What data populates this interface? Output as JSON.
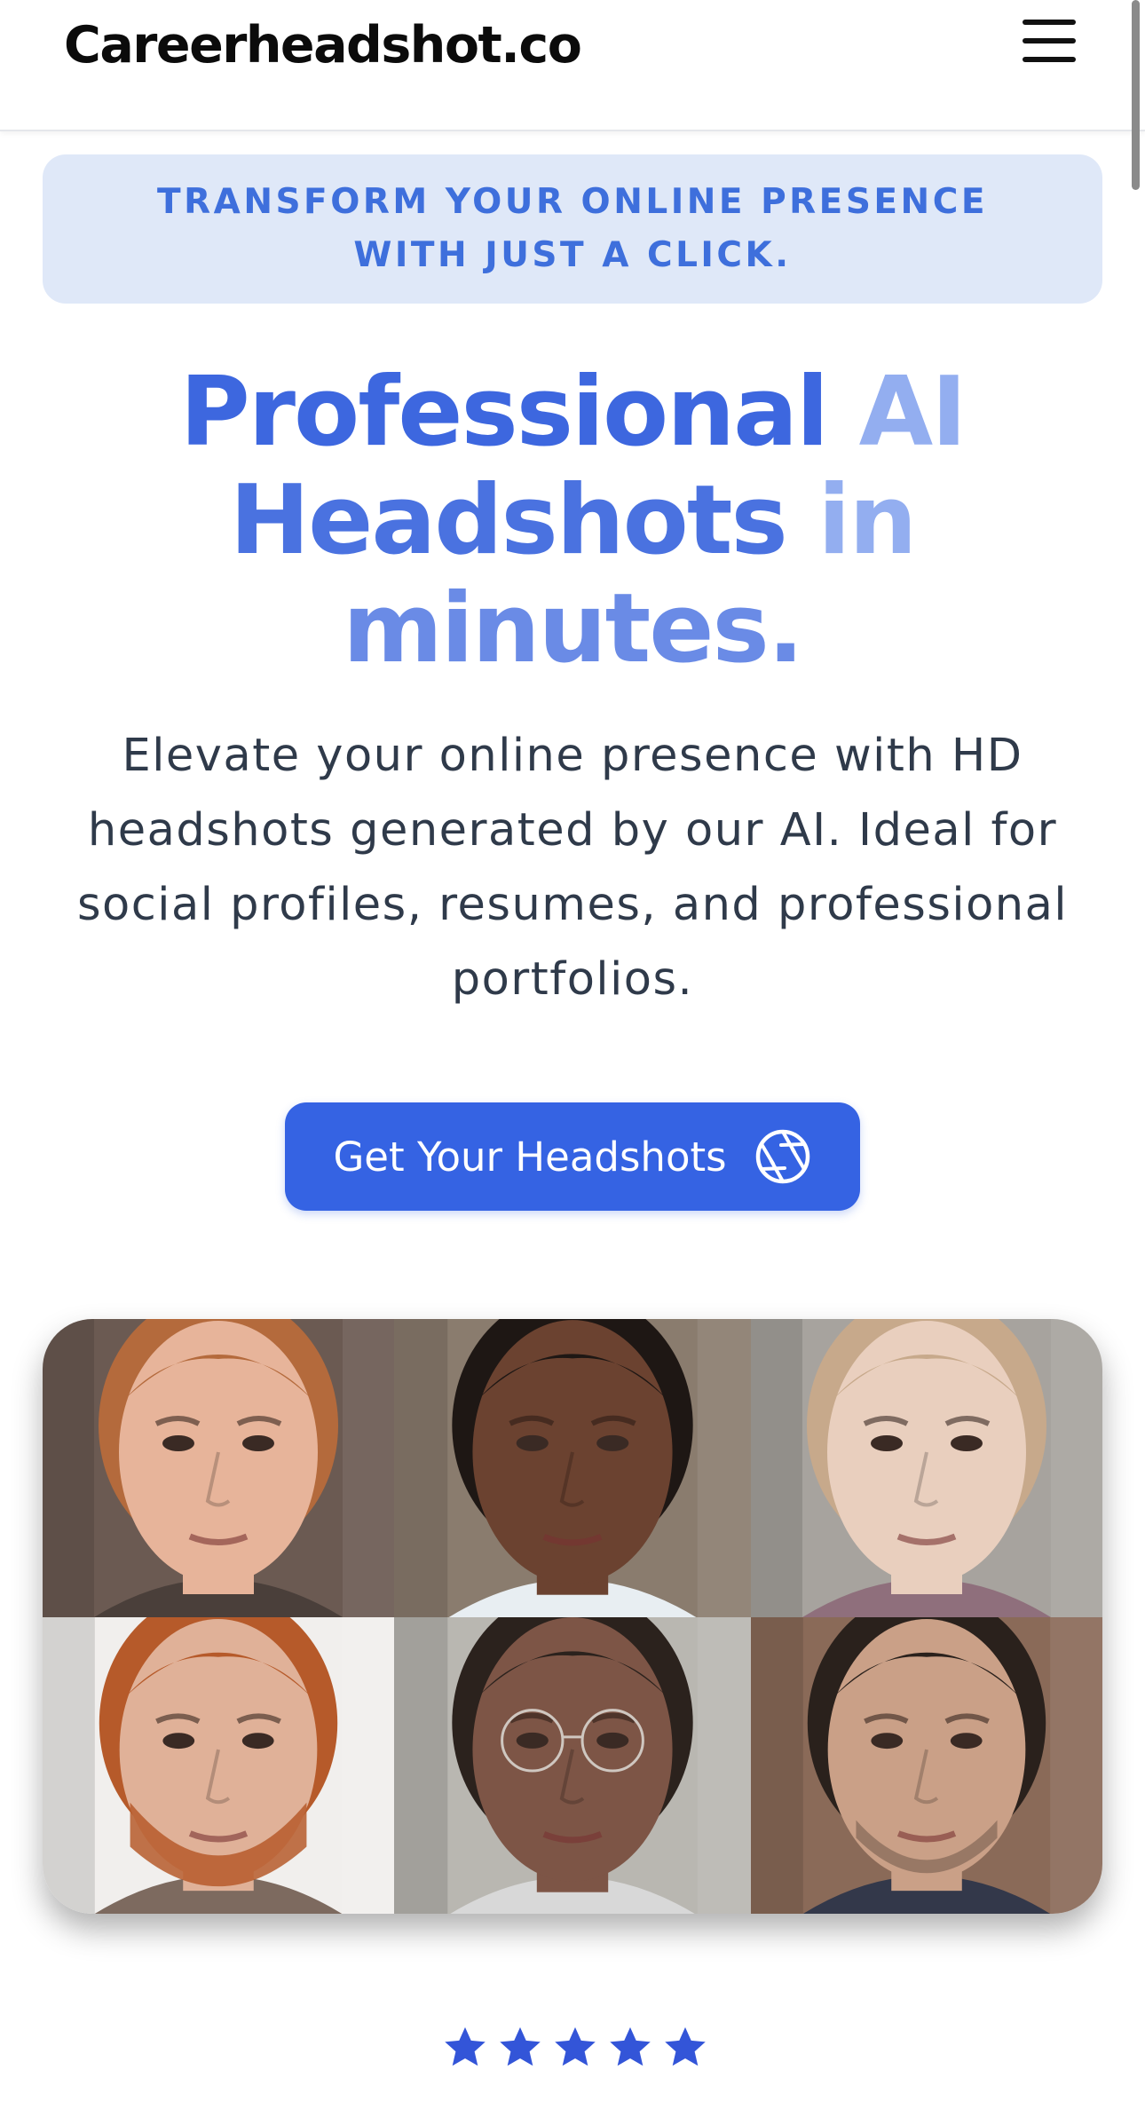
{
  "header": {
    "logo": "Careerheadshot.co",
    "menu_icon": "hamburger-menu-icon"
  },
  "banner": {
    "text": "TRANSFORM YOUR ONLINE PRESENCE WITH JUST A CLICK."
  },
  "hero": {
    "headline_words": [
      "Professional",
      "AI",
      "Headshots",
      "in",
      "minutes."
    ],
    "subtext": "Elevate your online presence with HD headshots generated by our AI. Ideal for social profiles, resumes, and professional portfolios.",
    "cta_label": "Get Your Headshots",
    "cta_icon": "camera-aperture-icon"
  },
  "gallery": {
    "faces": [
      {
        "hair": "#b46a3c",
        "skin": "#e7b49a",
        "bg": "#6b5a52",
        "shirt": "#4a3f3a"
      },
      {
        "hair": "#1e1714",
        "skin": "#6b4230",
        "bg": "#8a7c6e",
        "shirt": "#e8eef2"
      },
      {
        "hair": "#c7a98b",
        "skin": "#e9cfbe",
        "bg": "#a7a39e",
        "shirt": "#8f6f7c"
      },
      {
        "hair": "#b65a2a",
        "skin": "#e0b198",
        "bg": "#f1efed",
        "shirt": "#7d6a5f"
      },
      {
        "hair": "#2b221d",
        "skin": "#7d5546",
        "bg": "#b9b7b1",
        "shirt": "#d8d8d8"
      },
      {
        "hair": "#2a211c",
        "skin": "#caa087",
        "bg": "#8a6a58",
        "shirt": "#33384a"
      }
    ]
  },
  "rating": {
    "stars": 5,
    "star_color": "#3355d8"
  },
  "colors": {
    "accent": "#3563e3",
    "banner_bg": "#dfe8f8",
    "banner_text": "#3e6fdc"
  }
}
